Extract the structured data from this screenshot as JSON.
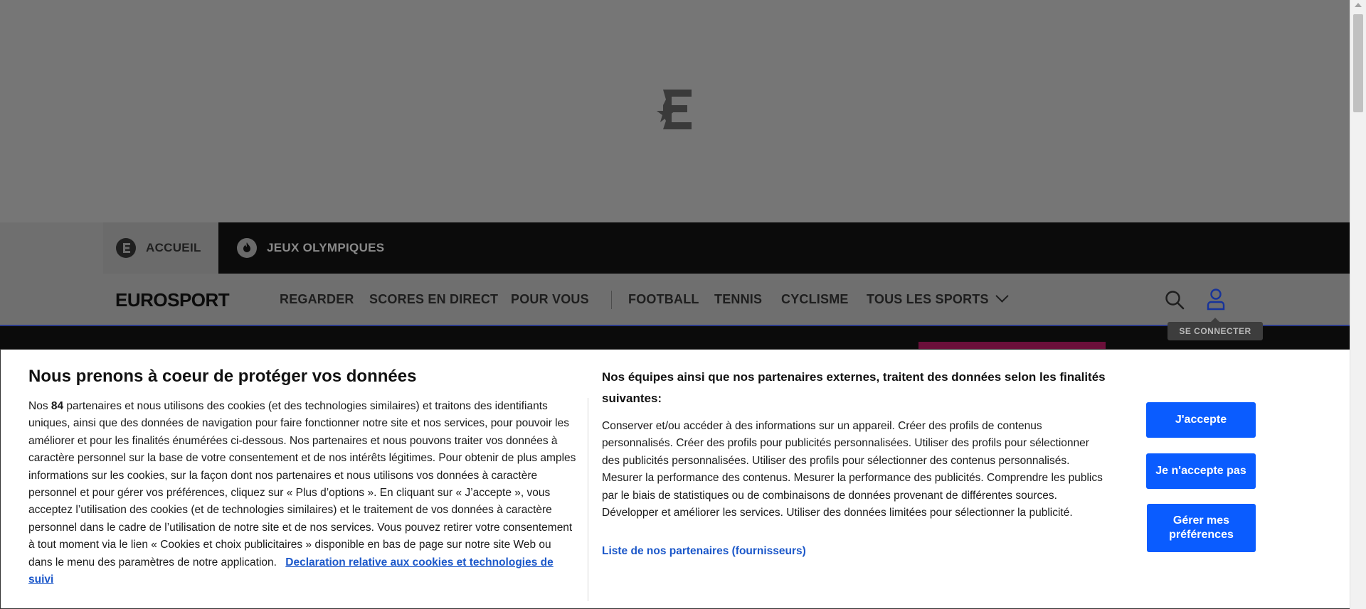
{
  "topnav": {
    "home_label": "ACCUEIL",
    "olympics_label": "JEUX OLYMPIQUES"
  },
  "mainnav": {
    "brand": "EUROSPORT",
    "items": [
      "REGARDER",
      "SCORES EN DIRECT",
      "POUR VOUS",
      "FOOTBALL",
      "TENNIS",
      "CYCLISME",
      "TOUS LES SPORTS"
    ],
    "login_tooltip": "SE CONNECTER"
  },
  "consent": {
    "title": "Nous prenons à coeur de protéger vos données",
    "body_prefix": "Nos ",
    "partner_count": "84",
    "body_text": " partenaires et nous utilisons des cookies (et des technologies similaires) et traitons des identifiants uniques, ainsi que des données de navigation pour faire fonctionner notre site et nos services, pour pouvoir les améliorer et pour les finalités énumérées ci-dessous. Nos partenaires et nous pouvons traiter vos données à caractère personnel sur la base de votre consentement et de nos intérêts légitimes. Pour obtenir de plus amples informations sur les cookies, sur la façon dont nos partenaires et nous utilisons vos données à caractère personnel et pour gérer vos préférences, cliquez sur « Plus d’options ». En cliquant sur « J’accepte », vous acceptez l’utilisation des cookies (et de technologies similaires) et le traitement de vos données à caractère personnel dans le cadre de l’utilisation de notre site et de nos services. Vous pouvez retirer votre consentement à tout moment via le lien « Cookies et choix publicitaires » disponible en bas de page sur notre site Web ou dans le menu des paramètres de notre application.",
    "policy_link": "Declaration relative aux cookies et technologies de suivi",
    "right_title": "Nos équipes ainsi que nos partenaires externes, traitent des données selon les finalités suivantes:",
    "purposes": "Conserver et/ou accéder à des informations sur un appareil. Créer des profils de contenus personnalisés. Créer des profils pour publicités personnalisées. Utiliser des profils pour sélectionner des publicités personnalisées. Utiliser des profils pour sélectionner des contenus personnalisés. Mesurer la performance des contenus. Mesurer la performance des publicités. Comprendre les publics par le biais de statistiques ou de combinaisons de données provenant de différentes sources. Développer et améliorer les services. Utiliser des données limitées pour sélectionner la publicité.",
    "partners_link": "Liste de nos partenaires (fournisseurs)",
    "accept_label": "J'accepte",
    "refuse_label": "Je n'accepte pas",
    "prefs_label": "Gérer mes préférences"
  },
  "colors": {
    "accent_blue": "#0a5cff",
    "link_blue": "#1b57c9",
    "overlay_gray": "#767676",
    "nav_black": "#0b0b0b"
  },
  "icons": [
    "eurosport-e-logo-icon",
    "home-e-icon",
    "olympic-flame-icon",
    "search-icon",
    "user-icon"
  ]
}
